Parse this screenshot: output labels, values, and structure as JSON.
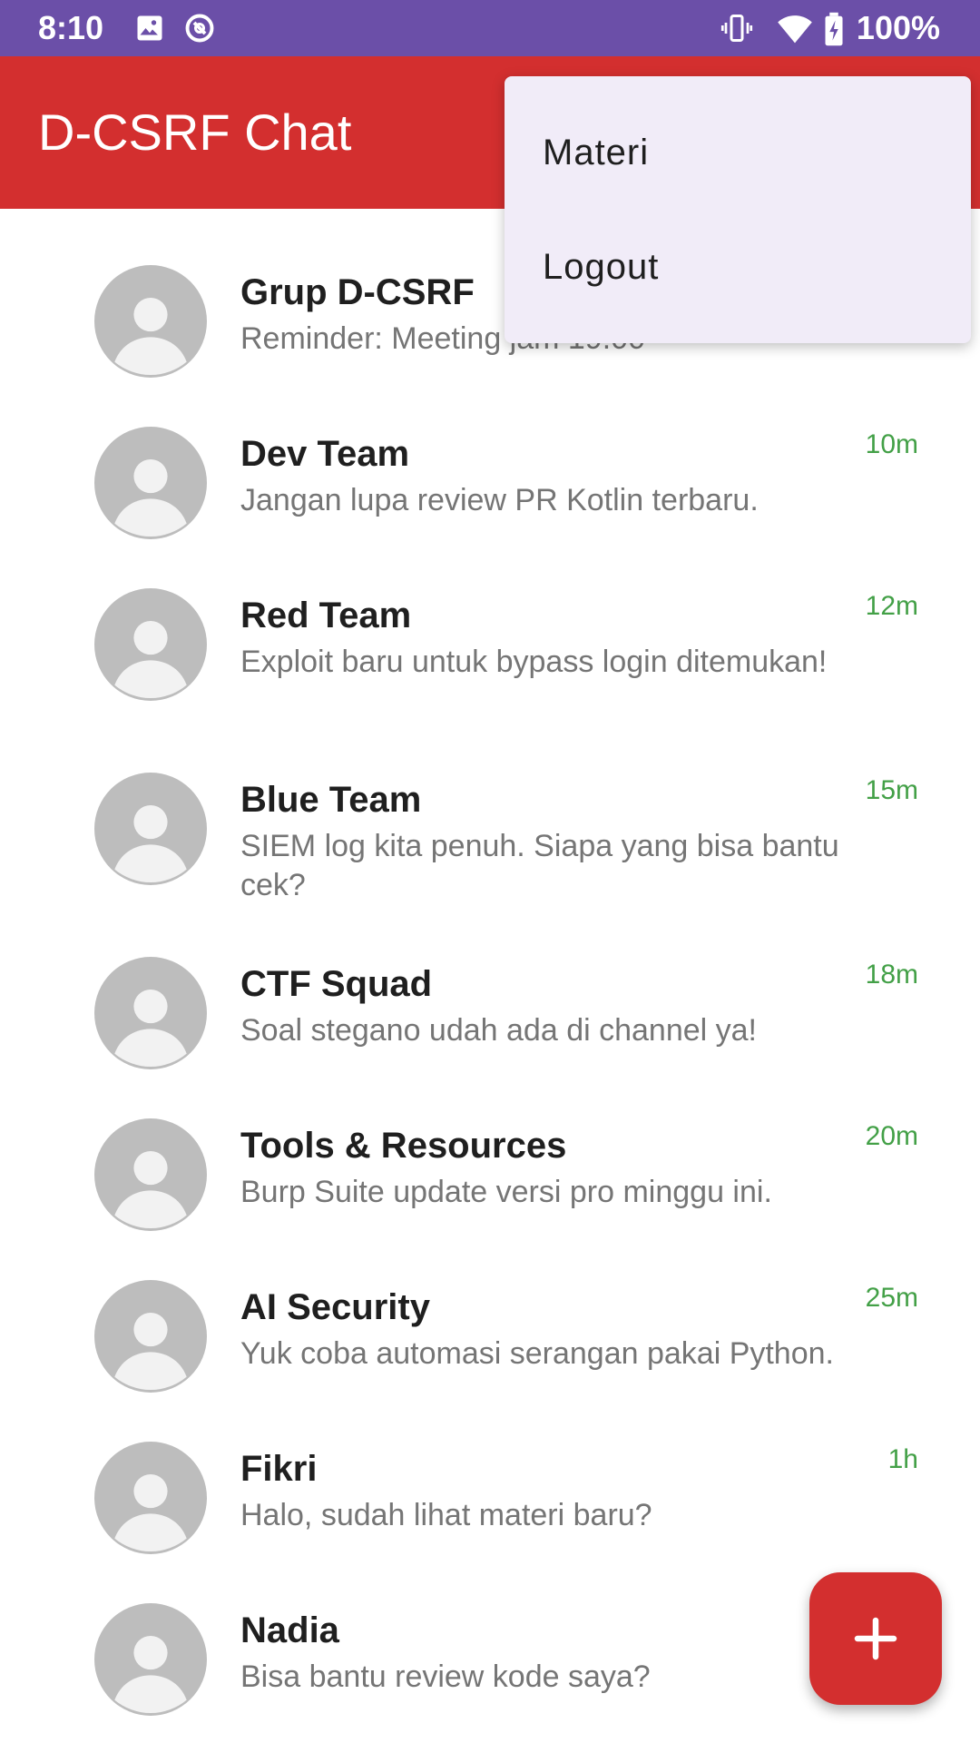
{
  "status_bar": {
    "time": "8:10",
    "battery": "100%",
    "icons": [
      "image-icon",
      "sync-icon",
      "vibrate-icon",
      "wifi-icon",
      "battery-charging-icon"
    ]
  },
  "app_bar": {
    "title": "D-CSRF Chat",
    "color": "#d32f2f"
  },
  "menu": {
    "items": [
      "Materi",
      "Logout"
    ]
  },
  "chats": [
    {
      "name": "Grup D-CSRF",
      "message": "Reminder: Meeting jam 19.00",
      "time": ""
    },
    {
      "name": "Dev Team",
      "message": "Jangan lupa review PR Kotlin terbaru.",
      "time": "10m"
    },
    {
      "name": "Red Team",
      "message": "Exploit baru untuk bypass login ditemukan!",
      "time": "12m"
    },
    {
      "name": "Blue Team",
      "message": "SIEM log kita penuh. Siapa yang bisa bantu cek?",
      "time": "15m"
    },
    {
      "name": "CTF Squad",
      "message": "Soal stegano udah ada di channel ya!",
      "time": "18m"
    },
    {
      "name": "Tools & Resources",
      "message": "Burp Suite update versi pro minggu ini.",
      "time": "20m"
    },
    {
      "name": "AI Security",
      "message": "Yuk coba automasi serangan pakai Python.",
      "time": "25m"
    },
    {
      "name": "Fikri",
      "message": "Halo, sudah lihat materi baru?",
      "time": "1h"
    },
    {
      "name": "Nadia",
      "message": "Bisa bantu review kode saya?",
      "time": ""
    }
  ],
  "fab": {
    "icon": "plus-icon"
  },
  "colors": {
    "status_bar": "#6b4fa8",
    "accent": "#d32f2f",
    "time_green": "#43a047"
  }
}
